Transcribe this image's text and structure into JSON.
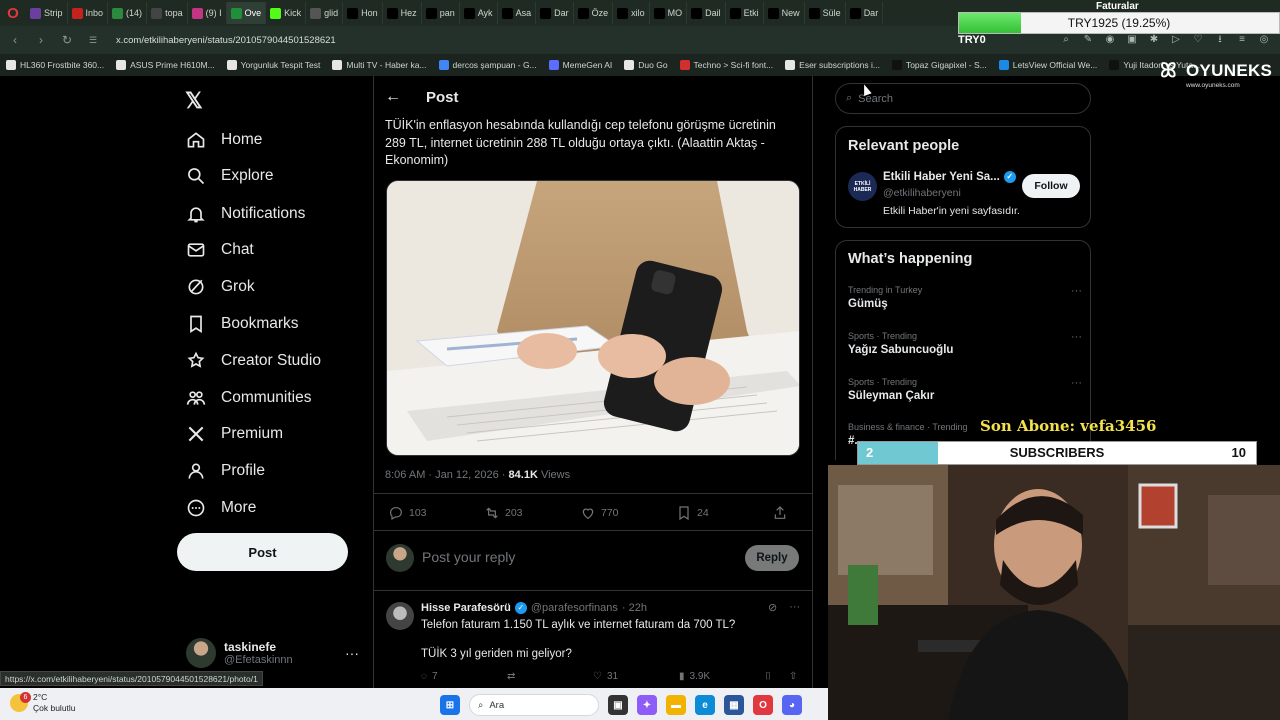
{
  "browser": {
    "tabs": [
      {
        "label": "Strip",
        "color": "#6b3fa0"
      },
      {
        "label": "Inbo",
        "color": "#c5221f"
      },
      {
        "label": "(14)",
        "color": "#2b8a3e"
      },
      {
        "label": "topa",
        "color": "#444444"
      },
      {
        "label": "(9) I",
        "color": "#c13584"
      },
      {
        "label": "Ove",
        "color": "#1f8f3a",
        "active": true
      },
      {
        "label": "Kick",
        "color": "#53fc18"
      },
      {
        "label": "glid",
        "color": "#555555"
      },
      {
        "label": "Hon",
        "color": "#000000"
      },
      {
        "label": "Hez",
        "color": "#000000"
      },
      {
        "label": "pan",
        "color": "#000000"
      },
      {
        "label": "Ayk",
        "color": "#000000"
      },
      {
        "label": "Asa",
        "color": "#000000"
      },
      {
        "label": "Dar",
        "color": "#000000"
      },
      {
        "label": "Öze",
        "color": "#000000"
      },
      {
        "label": "xilo",
        "color": "#000000"
      },
      {
        "label": "MO",
        "color": "#000000"
      },
      {
        "label": "Dail",
        "color": "#000000"
      },
      {
        "label": "Etki",
        "color": "#000000"
      },
      {
        "label": "New",
        "color": "#000000"
      },
      {
        "label": "Süle",
        "color": "#000000"
      },
      {
        "label": "Dar",
        "color": "#000000"
      }
    ],
    "url": "x.com/etkilihaberyeni/status/2010579044501528621",
    "bookmarks": [
      {
        "label": "HL360 Frostbite 360...",
        "color": "#e6e6e6"
      },
      {
        "label": "ASUS Prime H610M...",
        "color": "#e6e6e6"
      },
      {
        "label": "Yorgunluk Tespit Test",
        "color": "#e6e6e6"
      },
      {
        "label": "Multi TV - Haber ka...",
        "color": "#e6e6e6"
      },
      {
        "label": "dercos şampuan - G...",
        "color": "#4285f4"
      },
      {
        "label": "MemeGen AI",
        "color": "#5b6cff"
      },
      {
        "label": "Duo Go",
        "color": "#e6e6e6"
      },
      {
        "label": "Techno > Sci-fi font...",
        "color": "#d32f2f"
      },
      {
        "label": "Eser subscriptions i...",
        "color": "#e6e6e6"
      },
      {
        "label": "Topaz Gigapixel - S...",
        "color": "#111111"
      },
      {
        "label": "LetsView Official We...",
        "color": "#1e88e5"
      },
      {
        "label": "Yuji Itadori vs Yuta...",
        "color": "#111111"
      }
    ],
    "status_url": "https://x.com/etkilihaberyeni/status/2010579044501528621/photo/1"
  },
  "overlay": {
    "currency_title": "Faturalar",
    "currency_text": "TRY1925 (19.25%)",
    "currency_progress_percent": 19.25,
    "try_label": "TRY0",
    "brand": "OYUNEKS",
    "brand_sub": "www.oyuneks.com",
    "last_sub_label": "Son Abone: vefa3456",
    "sub_current": "2",
    "sub_label": "SUBSCRIBERS",
    "sub_goal": "10",
    "sub_progress_fraction": 0.2
  },
  "nav": {
    "items": [
      {
        "label": "Home",
        "icon": "home-icon"
      },
      {
        "label": "Explore",
        "icon": "search-icon"
      },
      {
        "label": "Notifications",
        "icon": "bell-icon"
      },
      {
        "label": "Chat",
        "icon": "mail-icon"
      },
      {
        "label": "Grok",
        "icon": "grok-icon"
      },
      {
        "label": "Bookmarks",
        "icon": "bookmark-icon"
      },
      {
        "label": "Creator Studio",
        "icon": "creator-studio-icon"
      },
      {
        "label": "Communities",
        "icon": "communities-icon"
      },
      {
        "label": "Premium",
        "icon": "x-premium-icon"
      },
      {
        "label": "Profile",
        "icon": "profile-icon"
      },
      {
        "label": "More",
        "icon": "more-icon"
      }
    ],
    "post_button": "Post",
    "account_name": "taskinefe",
    "account_handle": "@Efetaskinnn"
  },
  "post": {
    "header_title": "Post",
    "text": "TÜİK'in enflasyon hesabında kullandığı cep telefonu görüşme ücretinin 289 TL,  internet ücretinin 288 TL olduğu ortaya çıktı. (Alaattin Aktaş - Ekonomim)",
    "meta_time": "8:06 AM · Jan 12, 2026 · ",
    "views_count": "84.1K",
    "views_label": " Views",
    "replies": "103",
    "reposts": "203",
    "likes": "770",
    "bookmarks": "24",
    "reply_placeholder": "Post your reply",
    "reply_button": "Reply"
  },
  "reply": {
    "name": "Hisse Parafesörü",
    "handle": "@parafesorfinans",
    "time": "· 22h",
    "line1": "Telefon faturam 1.150 TL aylık ve internet faturam da 700 TL?",
    "line2": "TÜİK 3 yıl geriden mi geliyor?",
    "replies": "7",
    "likes": "31",
    "views": "3.9K"
  },
  "sidebar": {
    "search_placeholder": "Search",
    "relevant_title": "Relevant people",
    "person_name": "Etkili Haber Yeni Sa...",
    "person_handle": "@etkilihaberyeni",
    "person_bio": "Etkili Haber'in yeni sayfasıdır.",
    "person_avatar_text": "ETKİLİ HABER",
    "follow_button": "Follow",
    "happening_title": "What’s happening",
    "trends": [
      {
        "category": "Trending in Turkey",
        "name": "Gümüş"
      },
      {
        "category": "Sports · Trending",
        "name": "Yağız Sabuncuoğlu"
      },
      {
        "category": "Sports · Trending",
        "name": "Süleyman Çakır"
      },
      {
        "category": "Business & finance · Trending",
        "name": "#..."
      }
    ]
  },
  "taskbar": {
    "weather_badge": "6",
    "temperature": "2°C",
    "weather_desc": "Çok bulutlu",
    "search_label": "Ara"
  }
}
